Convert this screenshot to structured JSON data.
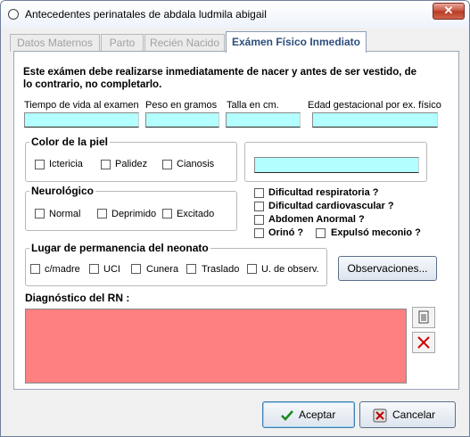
{
  "window": {
    "title": "Antecedentes perinatales de abdala ludmila abigail",
    "close_glyph": "✕"
  },
  "tabs": [
    {
      "label": "Datos Maternos",
      "active": false
    },
    {
      "label": "Parto",
      "active": false
    },
    {
      "label": "Recién Nacido",
      "active": false
    },
    {
      "label": "Exámen Físico Inmediato",
      "active": true
    }
  ],
  "notice": {
    "line1": "Este exámen debe realizarse inmediatamente de nacer y antes de ser vestido, de",
    "line2": "lo contrario, no completarlo."
  },
  "fields": {
    "tiempo_vida": {
      "label": "Tiempo de vida al examen",
      "value": ""
    },
    "peso": {
      "label": "Peso en gramos",
      "value": ""
    },
    "talla": {
      "label": "Talla en cm.",
      "value": ""
    },
    "edad_gestacional": {
      "label": "Edad gestacional por ex. físico",
      "value": ""
    },
    "otro_color": {
      "value": ""
    }
  },
  "color_piel": {
    "title": "Color de la piel",
    "options": [
      {
        "label": "Ictericia",
        "checked": false
      },
      {
        "label": "Palidez",
        "checked": false
      },
      {
        "label": "Cianosis",
        "checked": false
      }
    ]
  },
  "neurologico": {
    "title": "Neurológico",
    "options": [
      {
        "label": "Normal",
        "checked": false
      },
      {
        "label": "Deprimido",
        "checked": false
      },
      {
        "label": "Excitado",
        "checked": false
      }
    ]
  },
  "checks": {
    "dificultad_respiratoria": {
      "label": "Dificultad respiratoria ?",
      "checked": false
    },
    "dificultad_cardiovascular": {
      "label": "Dificultad cardiovascular ?",
      "checked": false
    },
    "abdomen_anormal": {
      "label": "Abdomen Anormal ?",
      "checked": false
    },
    "orino": {
      "label": "Orinó ?",
      "checked": false
    },
    "expulso_meconio": {
      "label": "Expulsó meconio ?",
      "checked": false
    }
  },
  "lugar": {
    "title": "Lugar de permanencia del neonato",
    "options": [
      {
        "label": "c/madre",
        "checked": false
      },
      {
        "label": "UCI",
        "checked": false
      },
      {
        "label": "Cunera",
        "checked": false
      },
      {
        "label": "Traslado",
        "checked": false
      },
      {
        "label": "U. de observ.",
        "checked": false
      }
    ]
  },
  "observaciones_button": "Observaciones...",
  "diagnostico": {
    "label": "Diagnóstico del RN :",
    "value": ""
  },
  "footer": {
    "accept_label": "Aceptar",
    "cancel_label": "Cancelar"
  },
  "colors": {
    "field_bg": "#b3ffff",
    "diagnostico_bg": "#ff8080",
    "active_tab_text": "#2c4e7c"
  }
}
